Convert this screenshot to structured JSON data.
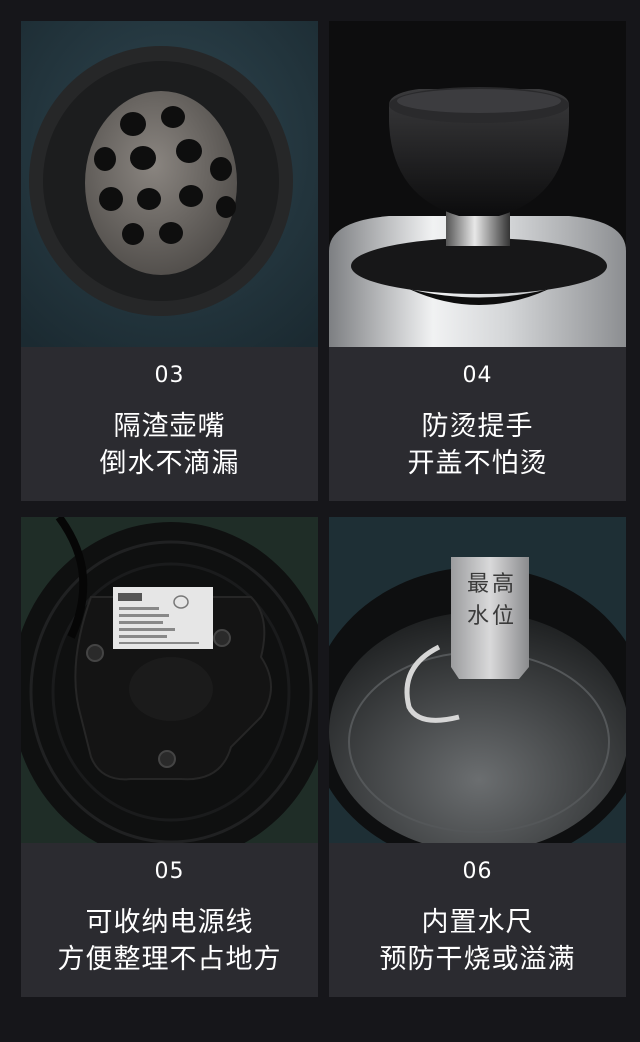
{
  "features": [
    {
      "number": "03",
      "line1": "隔渣壶嘴",
      "line2": "倒水不滴漏"
    },
    {
      "number": "04",
      "line1": "防烫提手",
      "line2": "开盖不怕烫"
    },
    {
      "number": "05",
      "line1": "可收纳电源线",
      "line2": "方便整理不占地方"
    },
    {
      "number": "06",
      "line1": "内置水尺",
      "line2": "预防干烧或溢满"
    }
  ],
  "water_gauge_label": "最高水位",
  "colors": {
    "page_background": "#16161a",
    "card_background": "#2b2b30",
    "text": "#ffffff"
  }
}
